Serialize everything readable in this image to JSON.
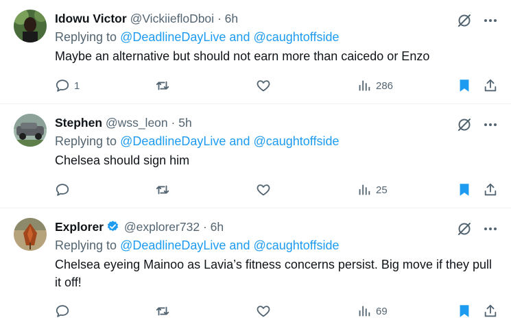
{
  "tweets": [
    {
      "name": "Idowu Victor",
      "handle": "@VickiiefloDboi",
      "time": "6h",
      "verified": false,
      "replying_prefix": "Replying to ",
      "replying_mentions": "@DeadlineDayLive and @caughtoffside",
      "text": "Maybe an alternative but should not earn more than caicedo or Enzo",
      "reply_count": "1",
      "retweet_count": "",
      "like_count": "",
      "view_count": "286",
      "bookmarked": true
    },
    {
      "name": "Stephen",
      "handle": "@wss_leon",
      "time": "5h",
      "verified": false,
      "replying_prefix": "Replying to ",
      "replying_mentions": "@DeadlineDayLive and @caughtoffside",
      "text": "Chelsea should sign him",
      "reply_count": "",
      "retweet_count": "",
      "like_count": "",
      "view_count": "25",
      "bookmarked": true
    },
    {
      "name": "Explorer",
      "handle": "@explorer732",
      "time": "6h",
      "verified": true,
      "replying_prefix": "Replying to ",
      "replying_mentions": "@DeadlineDayLive and @caughtoffside",
      "text": "Chelsea eyeing Mainoo as Lavia’s fitness concerns persist. Big move if they pull it off!",
      "reply_count": "",
      "retweet_count": "",
      "like_count": "",
      "view_count": "69",
      "bookmarked": true
    }
  ],
  "separator": "·",
  "colors": {
    "link": "#1d9bf0",
    "secondary_text": "#536471",
    "primary_text": "#0f1419",
    "divider": "#eff3f4"
  },
  "icons": {
    "reply": "reply-icon",
    "retweet": "retweet-icon",
    "like": "heart-icon",
    "views": "views-icon",
    "bookmark": "bookmark-icon",
    "share": "share-icon",
    "grok": "grok-icon",
    "more": "more-icon",
    "verified": "verified-badge-icon"
  }
}
